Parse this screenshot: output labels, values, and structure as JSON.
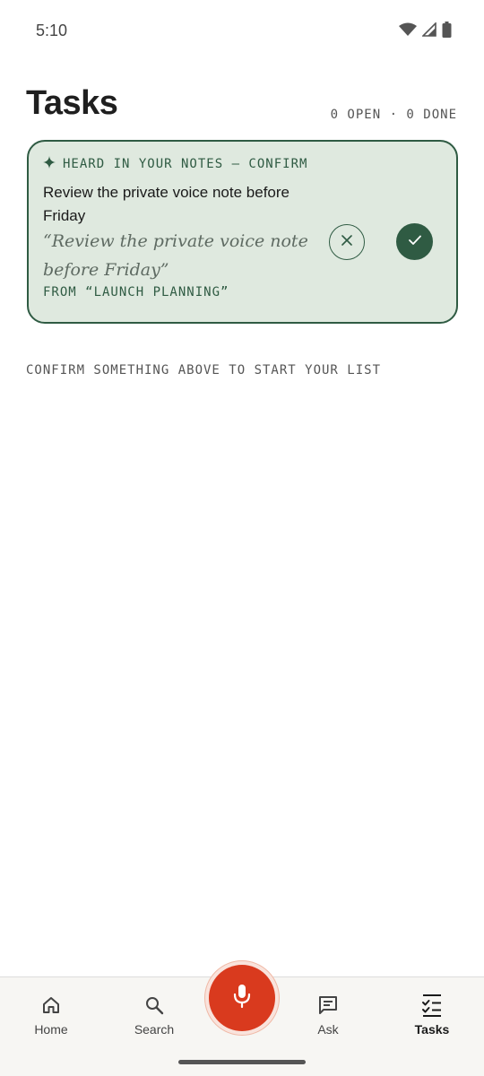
{
  "status_bar": {
    "time": "5:10",
    "icons": [
      "wifi-icon",
      "signal-icon",
      "battery-icon"
    ]
  },
  "header": {
    "title": "Tasks",
    "counts": "0 OPEN · 0 DONE"
  },
  "suggestion": {
    "header_icon": "sparkle-icon",
    "header_label": "HEARD IN YOUR NOTES — CONFIRM",
    "title": "Review the private voice note before Friday",
    "quote": "“Review the private voice note before Friday”",
    "source": "FROM “LAUNCH PLANNING”",
    "dismiss_icon": "close-icon",
    "confirm_icon": "check-icon"
  },
  "empty_hint": "CONFIRM SOMETHING ABOVE TO START YOUR LIST",
  "bottom_nav": {
    "items": [
      {
        "label": "Home",
        "icon": "home-icon",
        "active": false
      },
      {
        "label": "Search",
        "icon": "search-icon",
        "active": false
      },
      {
        "label": "Ask",
        "icon": "chat-icon",
        "active": false
      },
      {
        "label": "Tasks",
        "icon": "checklist-icon",
        "active": true
      }
    ],
    "mic_icon": "microphone-icon"
  },
  "colors": {
    "accent_green": "#2f5b43",
    "card_background": "#dfe9df",
    "mic_red": "#d93a1e"
  }
}
